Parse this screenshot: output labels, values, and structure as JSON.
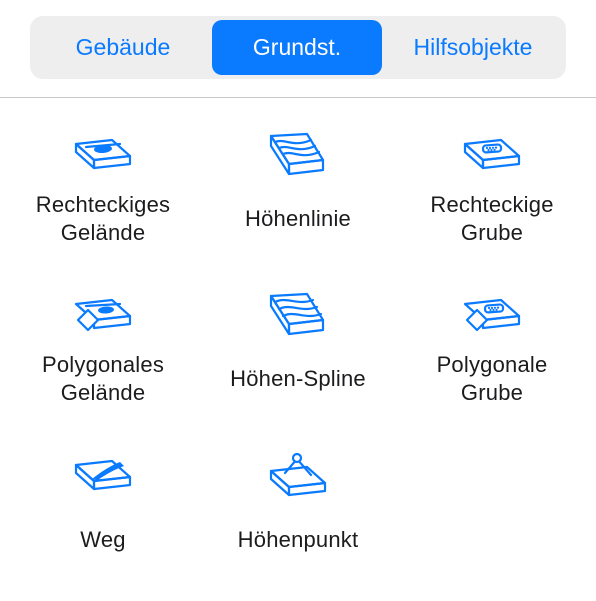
{
  "tabs": [
    {
      "label": "Gebäude",
      "active": false
    },
    {
      "label": "Grundst.",
      "active": true
    },
    {
      "label": "Hilfsobjekte",
      "active": false
    }
  ],
  "colors": {
    "accent": "#0a7aff",
    "segment_bg": "#eeeeef",
    "divider": "#c8c8cc",
    "text": "#1c1c1e"
  },
  "tools": [
    {
      "icon": "rectangular-terrain-icon",
      "label_lines": [
        "Rechteckiges",
        "Gelände"
      ]
    },
    {
      "icon": "contour-line-icon",
      "label_lines": [
        "Höhenlinie"
      ]
    },
    {
      "icon": "rectangular-pit-icon",
      "label_lines": [
        "Rechteckige",
        "Grube"
      ]
    },
    {
      "icon": "polygonal-terrain-icon",
      "label_lines": [
        "Polygonales",
        "Gelände"
      ]
    },
    {
      "icon": "contour-spline-icon",
      "label_lines": [
        "Höhen-Spline"
      ]
    },
    {
      "icon": "polygonal-pit-icon",
      "label_lines": [
        "Polygonale",
        "Grube"
      ]
    },
    {
      "icon": "path-icon",
      "label_lines": [
        "Weg"
      ]
    },
    {
      "icon": "elevation-point-icon",
      "label_lines": [
        "Höhenpunkt"
      ]
    }
  ]
}
